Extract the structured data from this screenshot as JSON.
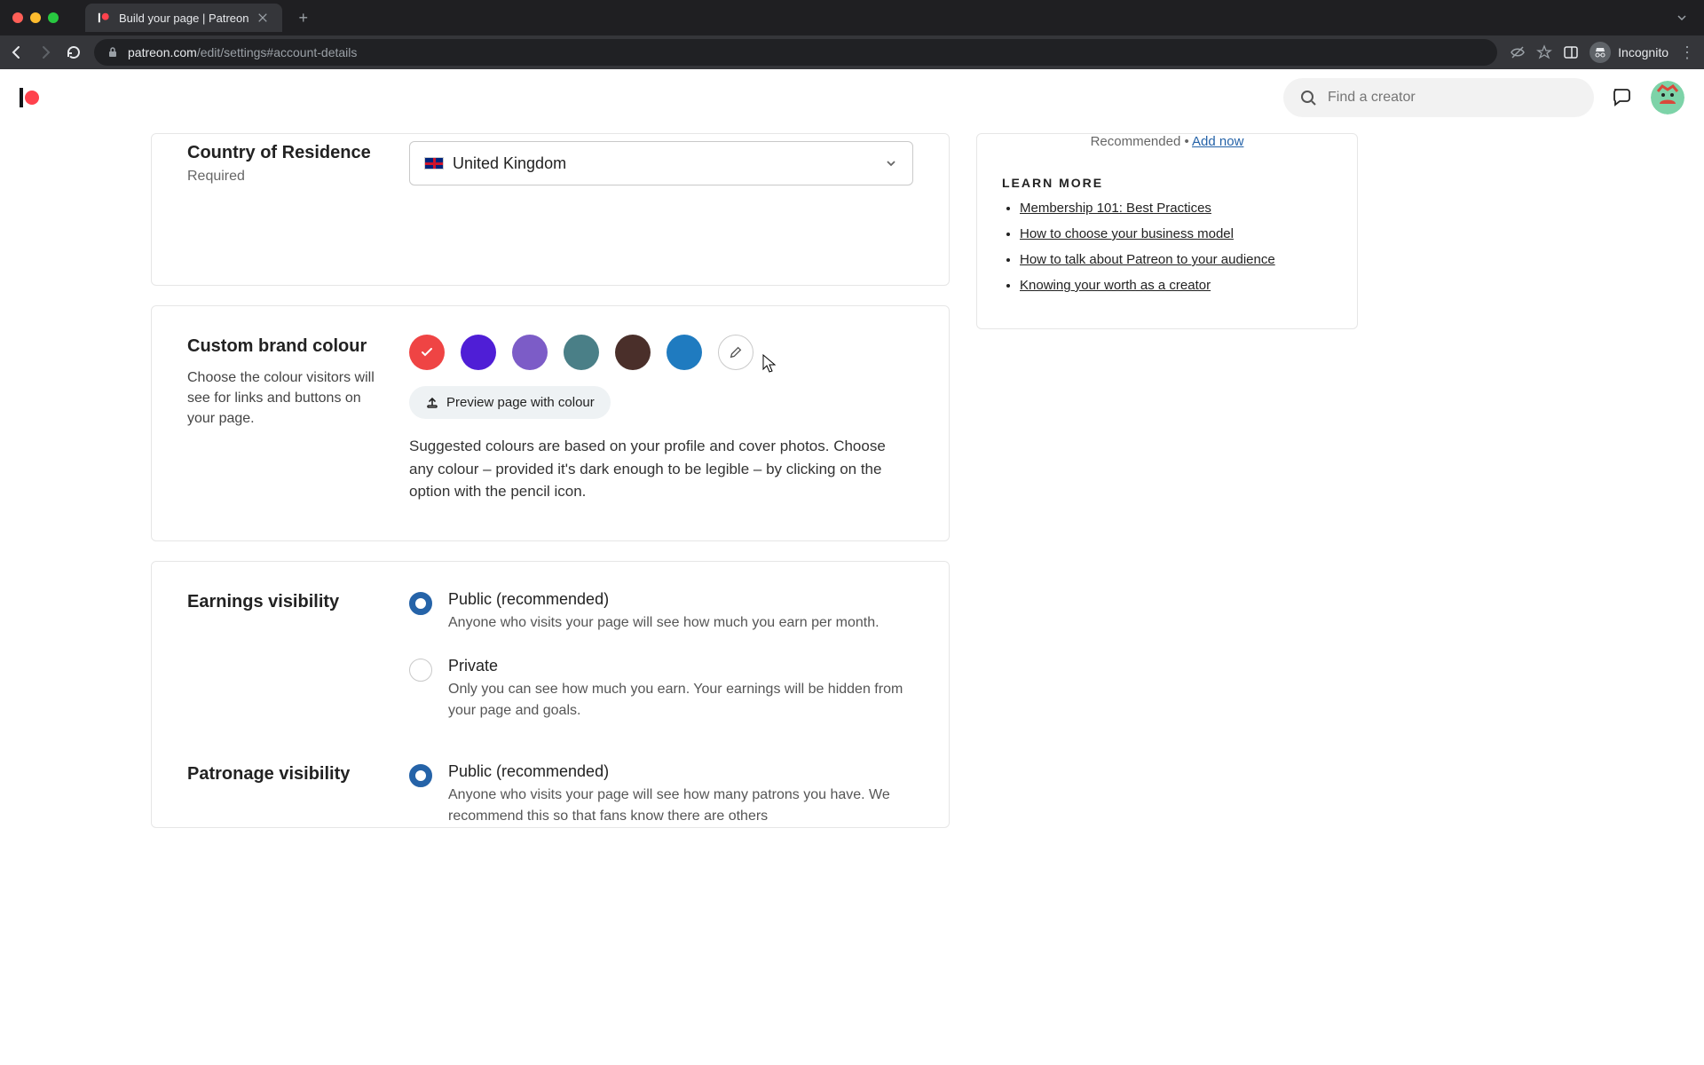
{
  "browser": {
    "tab_title": "Build your page | Patreon",
    "url_host": "patreon.com",
    "url_path": "/edit/settings#account-details",
    "incognito_label": "Incognito"
  },
  "header": {
    "search_placeholder": "Find a creator"
  },
  "country": {
    "heading": "Country of Residence",
    "required": "Required",
    "value": "United Kingdom"
  },
  "brand": {
    "heading": "Custom brand colour",
    "desc": "Choose the colour visitors will see for links and buttons on your page.",
    "colors": [
      "#ef4444",
      "#4f1ed6",
      "#7c5cc7",
      "#4a7f87",
      "#4a2f2a",
      "#1f7bc0"
    ],
    "selected_index": 0,
    "preview_label": "Preview page with colour",
    "helper": "Suggested colours are based on your profile and cover photos. Choose any colour – provided it's dark enough to be legible – by clicking on the option with the pencil icon."
  },
  "earnings": {
    "heading": "Earnings visibility",
    "options": [
      {
        "title": "Public (recommended)",
        "desc": "Anyone who visits your page will see how much you earn per month.",
        "checked": true
      },
      {
        "title": "Private",
        "desc": "Only you can see how much you earn. Your earnings will be hidden from your page and goals.",
        "checked": false
      }
    ]
  },
  "patronage": {
    "heading": "Patronage visibility",
    "options": [
      {
        "title": "Public (recommended)",
        "desc": "Anyone who visits your page will see how many patrons you have. We recommend this so that fans know there are others",
        "checked": true
      }
    ]
  },
  "sidebar": {
    "recommended": "Recommended",
    "add_now": "Add now",
    "learn_more": "LEARN MORE",
    "links": [
      "Membership 101: Best Practices",
      "How to choose your business model",
      "How to talk about Patreon to your audience",
      "Knowing your worth as a creator"
    ]
  }
}
